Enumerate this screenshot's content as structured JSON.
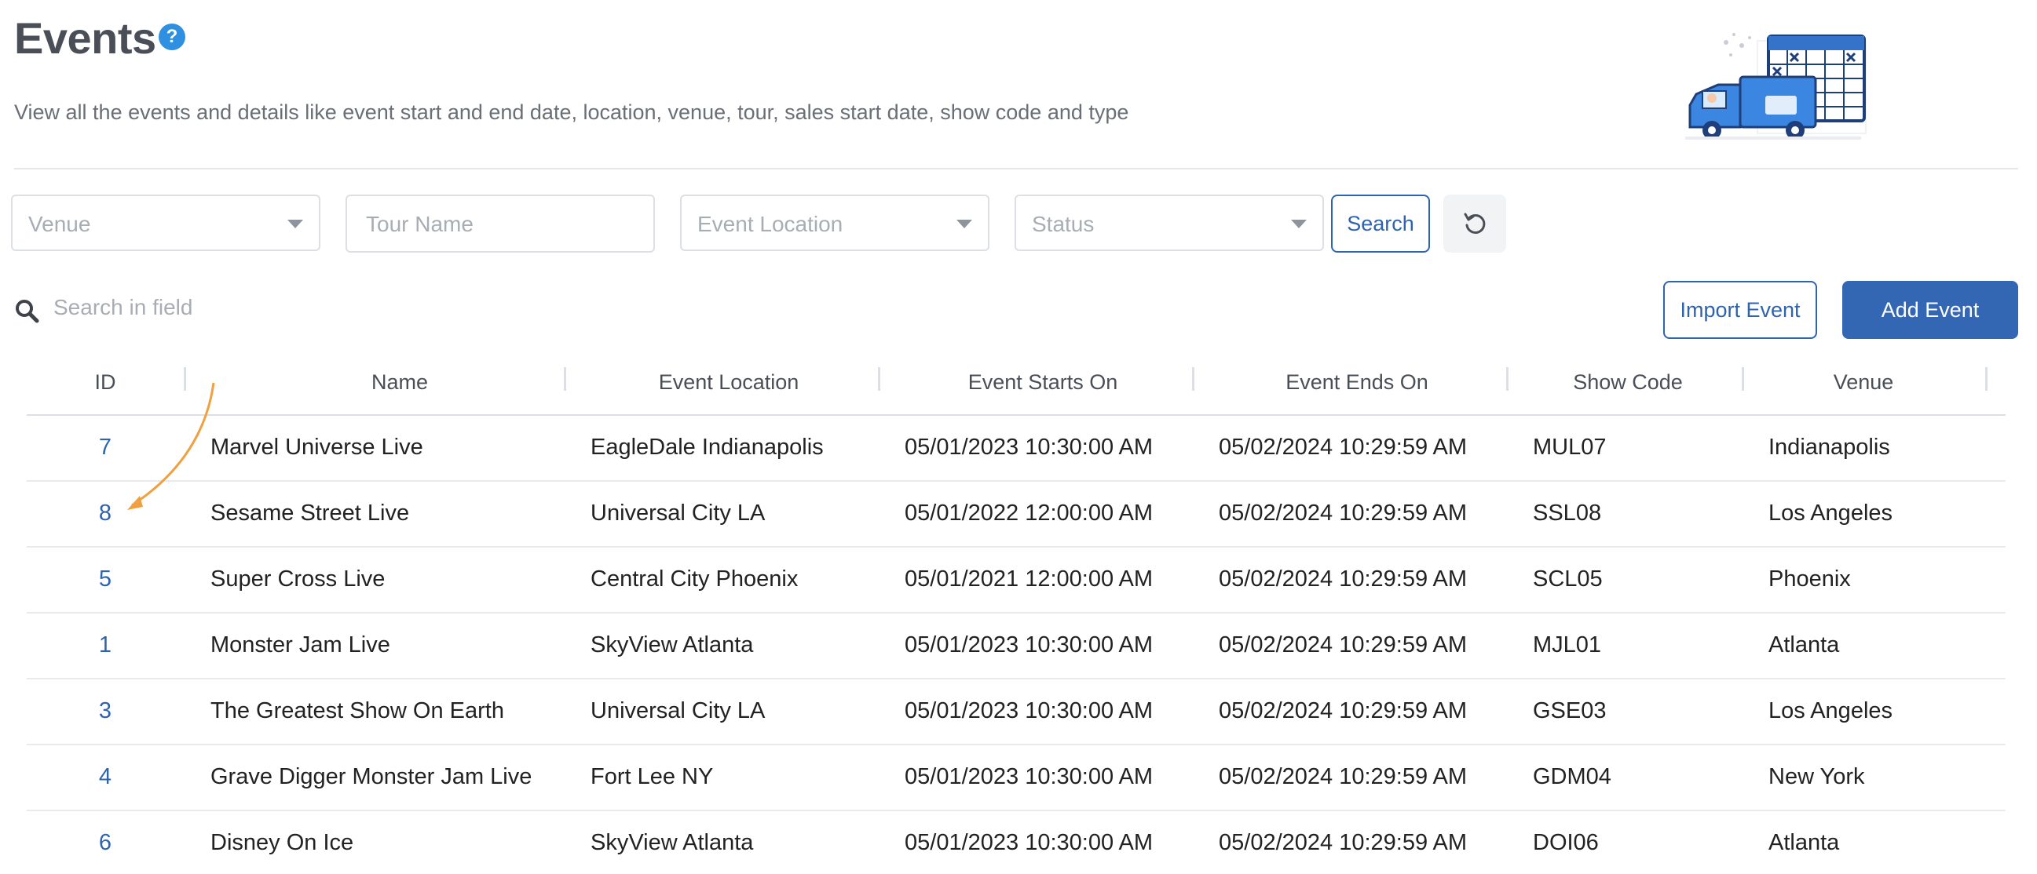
{
  "page": {
    "title": "Events",
    "description": "View all the events and details like event start and end date, location, venue, tour, sales start date, show code and type"
  },
  "filters": {
    "venue_placeholder": "Venue",
    "tour_placeholder": "Tour Name",
    "location_placeholder": "Event Location",
    "status_placeholder": "Status",
    "search_label": "Search"
  },
  "toolbar": {
    "search_placeholder": "Search in field",
    "import_label": "Import Event",
    "add_label": "Add Event"
  },
  "table": {
    "columns": [
      "ID",
      "Name",
      "Event Location",
      "Event Starts On",
      "Event Ends On",
      "Show Code",
      "Venue"
    ],
    "rows": [
      {
        "id": "7",
        "name": "Marvel Universe Live",
        "location": "EagleDale Indianapolis",
        "starts": "05/01/2023 10:30:00 AM",
        "ends": "05/02/2024 10:29:59 AM",
        "code": "MUL07",
        "venue": "Indianapolis"
      },
      {
        "id": "8",
        "name": "Sesame Street Live",
        "location": "Universal City LA",
        "starts": "05/01/2022 12:00:00 AM",
        "ends": "05/02/2024 10:29:59 AM",
        "code": "SSL08",
        "venue": "Los Angeles"
      },
      {
        "id": "5",
        "name": "Super Cross Live",
        "location": "Central City Phoenix",
        "starts": "05/01/2021 12:00:00 AM",
        "ends": "05/02/2024 10:29:59 AM",
        "code": "SCL05",
        "venue": "Phoenix"
      },
      {
        "id": "1",
        "name": "Monster Jam Live",
        "location": "SkyView Atlanta",
        "starts": "05/01/2023 10:30:00 AM",
        "ends": "05/02/2024 10:29:59 AM",
        "code": "MJL01",
        "venue": "Atlanta"
      },
      {
        "id": "3",
        "name": "The Greatest Show On Earth",
        "location": "Universal City LA",
        "starts": "05/01/2023 10:30:00 AM",
        "ends": "05/02/2024 10:29:59 AM",
        "code": "GSE03",
        "venue": "Los Angeles"
      },
      {
        "id": "4",
        "name": "Grave Digger Monster Jam Live",
        "location": "Fort Lee NY",
        "starts": "05/01/2023 10:30:00 AM",
        "ends": "05/02/2024 10:29:59 AM",
        "code": "GDM04",
        "venue": "New York"
      },
      {
        "id": "6",
        "name": "Disney On Ice",
        "location": "SkyView Atlanta",
        "starts": "05/01/2023 10:30:00 AM",
        "ends": "05/02/2024 10:29:59 AM",
        "code": "DOI06",
        "venue": "Atlanta"
      }
    ]
  },
  "icons": {
    "help": "help-icon",
    "search": "search-icon",
    "reset": "reset-icon",
    "caret": "chevron-down-icon",
    "illustration": "delivery-truck-calendar-illustration"
  },
  "colors": {
    "accent": "#3467b3",
    "link": "#2e64ad",
    "help": "#2f8fe0",
    "annotation_arrow": "#f0a040"
  }
}
